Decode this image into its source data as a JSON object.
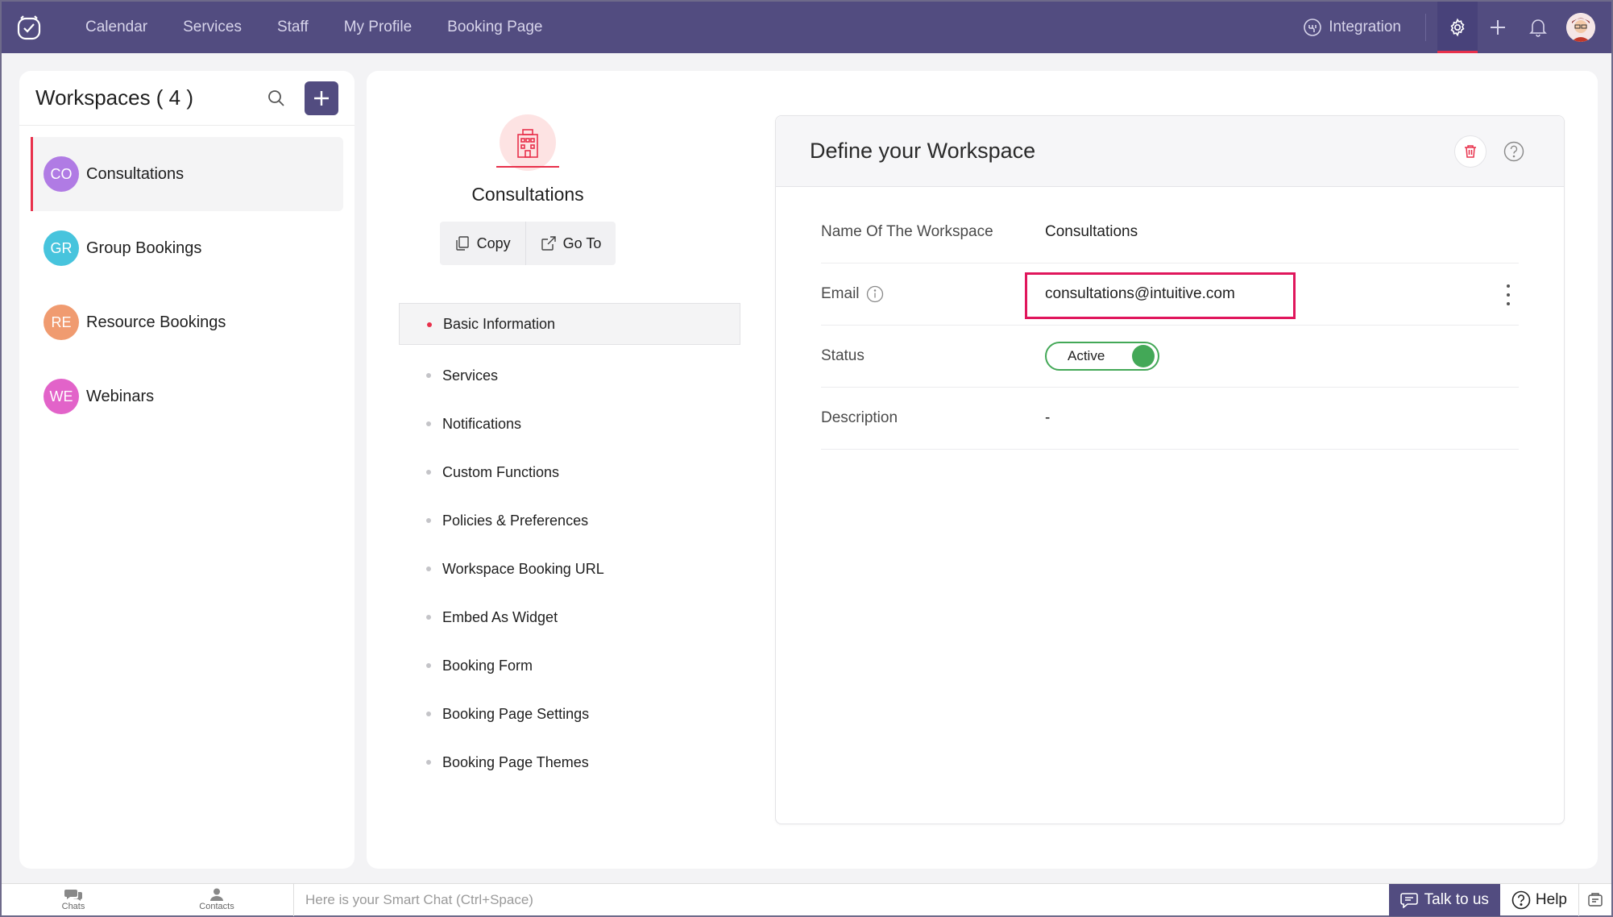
{
  "nav": {
    "items": [
      "Calendar",
      "Services",
      "Staff",
      "My Profile",
      "Booking Page"
    ],
    "integration_label": "Integration"
  },
  "sidebar": {
    "title": "Workspaces ( 4 )",
    "items": [
      {
        "initials": "CO",
        "name": "Consultations",
        "color": "#b07be4"
      },
      {
        "initials": "GR",
        "name": "Group Bookings",
        "color": "#47c4dd"
      },
      {
        "initials": "RE",
        "name": "Resource Bookings",
        "color": "#f09b70"
      },
      {
        "initials": "WE",
        "name": "Webinars",
        "color": "#e263c9"
      }
    ]
  },
  "workspace": {
    "name": "Consultations",
    "copy_label": "Copy",
    "goto_label": "Go To"
  },
  "menu": {
    "items": [
      "Basic Information",
      "Services",
      "Notifications",
      "Custom Functions",
      "Policies & Preferences",
      "Workspace Booking URL",
      "Embed As Widget",
      "Booking Form",
      "Booking Page Settings",
      "Booking Page Themes"
    ]
  },
  "card": {
    "title": "Define your Workspace",
    "rows": {
      "name_label": "Name Of The Workspace",
      "name_value": "Consultations",
      "email_label": "Email",
      "email_value": "consultations@intuitive.com",
      "status_label": "Status",
      "status_value": "Active",
      "description_label": "Description",
      "description_value": "-"
    }
  },
  "bottom": {
    "chats_label": "Chats",
    "contacts_label": "Contacts",
    "smart_chat_placeholder": "Here is your Smart Chat (Ctrl+Space)",
    "talk_label": "Talk to us",
    "help_label": "Help"
  },
  "colors": {
    "nav_bg": "#524c80",
    "accent_red": "#e8304b",
    "highlight_pink": "#e0165c",
    "active_green": "#43a857"
  }
}
